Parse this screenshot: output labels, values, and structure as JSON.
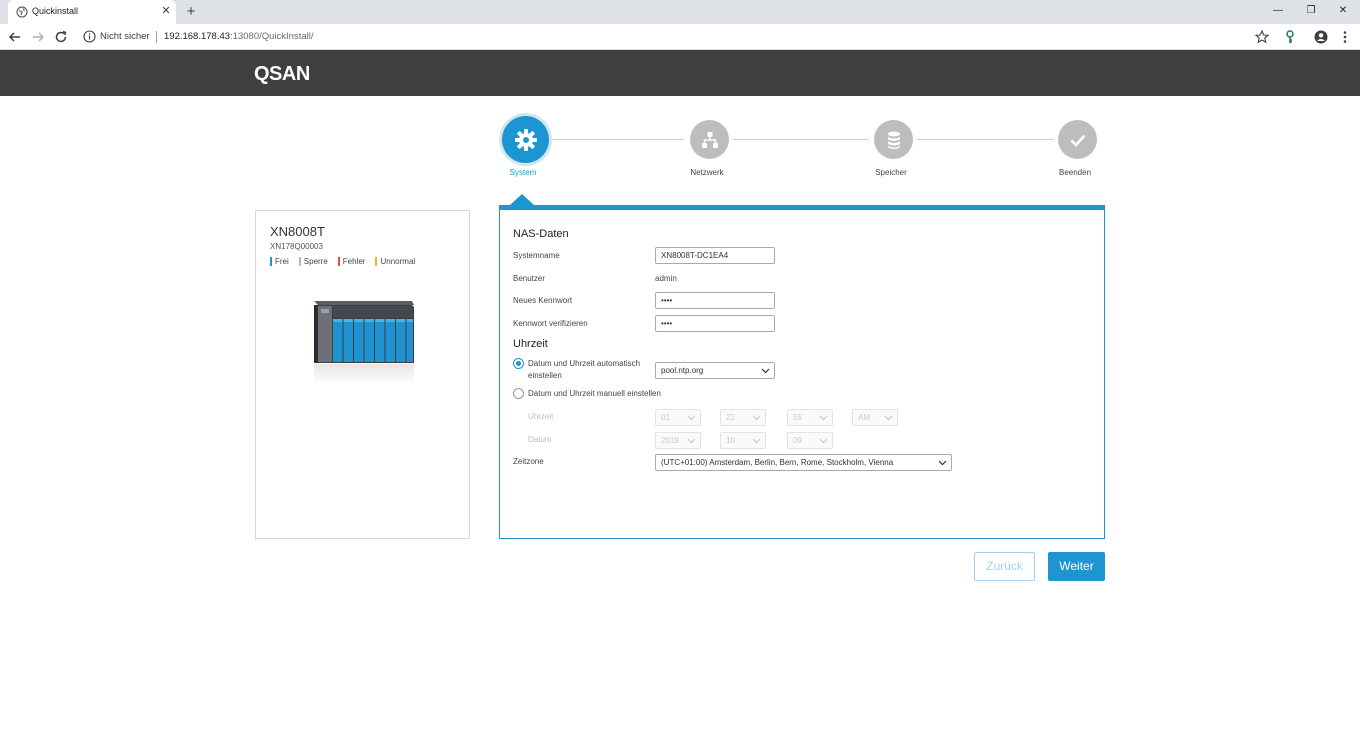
{
  "browser": {
    "tab_title": "Quickinstall",
    "tab_close": "✕",
    "new_tab": "+",
    "security_text": "Nicht sicher",
    "url_host": "192.168.178.43",
    "url_rest": ":13080/QuickInstall/",
    "window_minimize": "—",
    "window_restore": "❐",
    "window_close": "✕"
  },
  "header": {
    "logo": "QSAN"
  },
  "stepper": {
    "steps": [
      {
        "label": "System",
        "icon": "gear-icon",
        "state": "active"
      },
      {
        "label": "Netzwerk",
        "icon": "network-icon",
        "state": "inactive"
      },
      {
        "label": "Speicher",
        "icon": "database-icon",
        "state": "inactive"
      },
      {
        "label": "Beenden",
        "icon": "check-icon",
        "state": "inactive"
      }
    ]
  },
  "device": {
    "name": "XN8008T",
    "serial": "XN178Q00003",
    "legend": [
      {
        "label": "Frei",
        "color": "#1d95d3"
      },
      {
        "label": "Sperre",
        "color": "#b8b8b8"
      },
      {
        "label": "Fehler",
        "color": "#e2583e"
      },
      {
        "label": "Unnormal",
        "color": "#f0b429"
      }
    ]
  },
  "form": {
    "nas_section_title": "NAS-Daten",
    "system_name_label": "Systemname",
    "system_name_value": "XN8008T-DC1EA4",
    "user_label": "Benutzer",
    "user_value": "admin",
    "new_password_label": "Neues Kennwort",
    "new_password_value": "••••",
    "verify_password_label": "Kennwort verifizieren",
    "verify_password_value": "••••",
    "time_section_title": "Uhrzeit",
    "auto_time_label_line1": "Datum und Uhrzeit automatisch",
    "auto_time_label_line2": "einstellen",
    "ntp_server_value": "pool.ntp.org",
    "manual_time_label": "Datum und Uhrzeit manuell einstellen",
    "time_label": "Uhrzeit",
    "hour_value": "01",
    "minute_value": "22",
    "second_value": "55",
    "ampm_value": "AM",
    "date_label": "Datum",
    "year_value": "2019",
    "month_value": "10",
    "day_value": "09",
    "timezone_label": "Zeitzone",
    "timezone_value": "(UTC+01:00) Amsterdam, Berlin, Bern, Rome, Stockholm, Vienna"
  },
  "buttons": {
    "back": "Zurück",
    "next": "Weiter"
  },
  "colors": {
    "accent": "#1d95d3",
    "header_bg": "#3f3f3f",
    "inactive_step": "#bdbdbd"
  }
}
